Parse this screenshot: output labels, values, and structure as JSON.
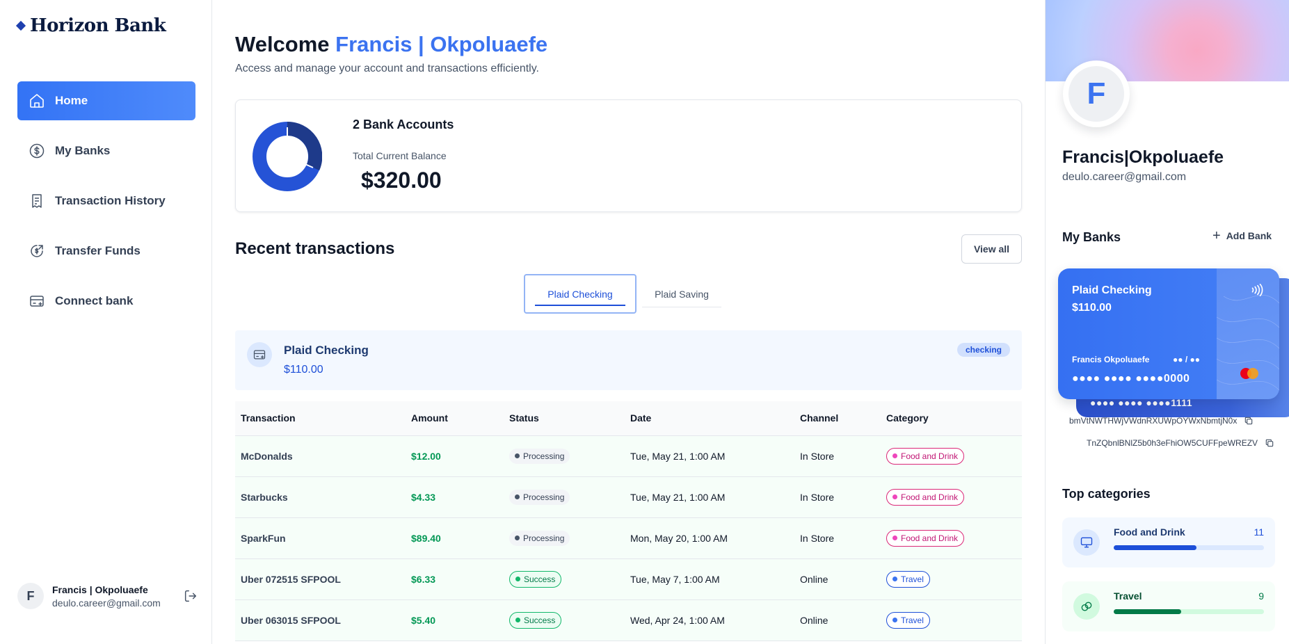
{
  "sidebar": {
    "logo": "Horizon Bank",
    "nav": [
      {
        "label": "Home",
        "icon": "home-icon",
        "active": true
      },
      {
        "label": "My Banks",
        "icon": "dollar-circle-icon",
        "active": false
      },
      {
        "label": "Transaction History",
        "icon": "receipt-icon",
        "active": false
      },
      {
        "label": "Transfer Funds",
        "icon": "money-send-icon",
        "active": false
      },
      {
        "label": "Connect bank",
        "icon": "bank-card-add-icon",
        "active": false
      }
    ],
    "footer": {
      "initial": "F",
      "name": "Francis | Okpoluaefe",
      "email": "deulo.career@gmail.com"
    }
  },
  "main": {
    "welcome_prefix": "Welcome",
    "welcome_name": "Francis | Okpoluaefe",
    "subtitle": "Access and manage your account and transactions efficiently.",
    "balance": {
      "accounts_label": "2 Bank Accounts",
      "total_label": "Total Current Balance",
      "total_value": "$320.00"
    },
    "recent": {
      "title": "Recent transactions",
      "view_all": "View all",
      "tabs": [
        {
          "label": "Plaid Checking",
          "active": true
        },
        {
          "label": "Plaid Saving",
          "active": false
        }
      ],
      "selected_bank": {
        "name": "Plaid Checking",
        "amount": "$110.00",
        "badge": "checking"
      },
      "columns": [
        "Transaction",
        "Amount",
        "Status",
        "Date",
        "Channel",
        "Category"
      ],
      "rows": [
        {
          "name": "McDonalds",
          "amount": "$12.00",
          "status": "Processing",
          "date": "Tue, May 21, 1:00 AM",
          "channel": "In Store",
          "category": "Food and Drink"
        },
        {
          "name": "Starbucks",
          "amount": "$4.33",
          "status": "Processing",
          "date": "Tue, May 21, 1:00 AM",
          "channel": "In Store",
          "category": "Food and Drink"
        },
        {
          "name": "SparkFun",
          "amount": "$89.40",
          "status": "Processing",
          "date": "Mon, May 20, 1:00 AM",
          "channel": "In Store",
          "category": "Food and Drink"
        },
        {
          "name": "Uber 072515 SFPOOL",
          "amount": "$6.33",
          "status": "Success",
          "date": "Tue, May 7, 1:00 AM",
          "channel": "Online",
          "category": "Travel"
        },
        {
          "name": "Uber 063015 SFPOOL",
          "amount": "$5.40",
          "status": "Success",
          "date": "Wed, Apr 24, 1:00 AM",
          "channel": "Online",
          "category": "Travel"
        }
      ]
    }
  },
  "right": {
    "profile": {
      "initial": "F",
      "name": "Francis|Okpoluaefe",
      "email": "deulo.career@gmail.com"
    },
    "my_banks_title": "My Banks",
    "add_bank": "Add Bank",
    "cards": [
      {
        "name": "Plaid Checking",
        "amount": "$110.00",
        "holder": "Francis Okpoluaefe",
        "expiry": "●● / ●●",
        "number": "●●●● ●●●● ●●●●0000"
      },
      {
        "number": "●●●● ●●●● ●●●●1111"
      }
    ],
    "account_ids": [
      "bmVtNWTHWjVWdnRXUWpOYWxNbmtjN0x",
      "TnZQbnlBNlZ5b0h3eFhiOW5CUFFpeWREZV"
    ],
    "top_categories_title": "Top categories",
    "categories": [
      {
        "name": "Food and Drink",
        "count": "11",
        "fill": 0.55
      },
      {
        "name": "Travel",
        "count": "9",
        "fill": 0.45
      }
    ]
  },
  "colors": {
    "accent": "#3373f5",
    "success": "#039855",
    "food": "#db2777",
    "travel": "#1d4fd8"
  }
}
